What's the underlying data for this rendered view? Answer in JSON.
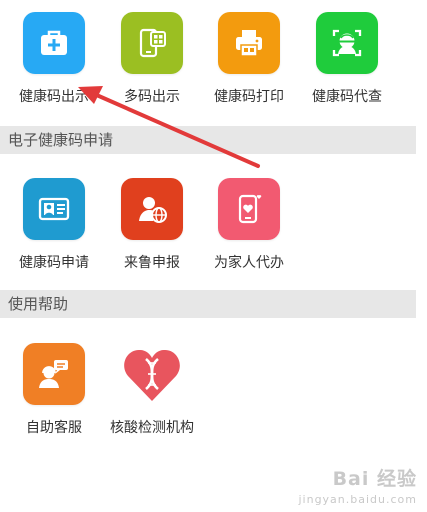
{
  "top_row": {
    "items": [
      {
        "label": "健康码出示",
        "icon": "medical-kit-icon",
        "color": "#27a9f4"
      },
      {
        "label": "多码出示",
        "icon": "phone-qr-icon",
        "color": "#9bbf22"
      },
      {
        "label": "健康码打印",
        "icon": "printer-icon",
        "color": "#f39b0e"
      },
      {
        "label": "健康码代查",
        "icon": "face-scan-icon",
        "color": "#1fcc3c"
      }
    ]
  },
  "section_apply": {
    "title": "电子健康码申请",
    "items": [
      {
        "label": "健康码申请",
        "icon": "id-card-icon",
        "color": "#1f9bd0"
      },
      {
        "label": "来鲁申报",
        "icon": "person-globe-icon",
        "color": "#e0401e"
      },
      {
        "label": "为家人代办",
        "icon": "phone-heart-icon",
        "color": "#f25a71"
      }
    ]
  },
  "section_help": {
    "title": "使用帮助",
    "items": [
      {
        "label": "自助客服",
        "icon": "customer-service-icon",
        "color": "#f07f25"
      },
      {
        "label": "核酸检测机构",
        "icon": "dna-heart-icon",
        "color": "#e8555e"
      }
    ]
  },
  "watermark": {
    "main": "Bai 经验",
    "sub": "jingyan.baidu.com"
  }
}
